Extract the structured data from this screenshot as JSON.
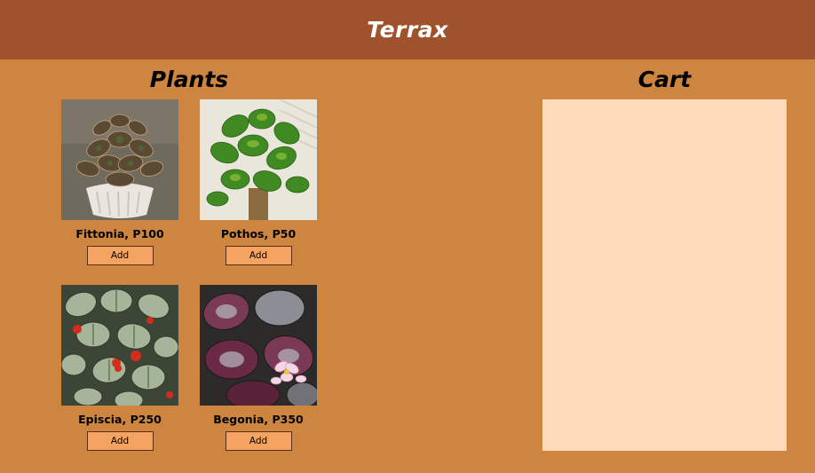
{
  "app": {
    "title": "Terrax"
  },
  "plants": {
    "title": "Plants",
    "items": [
      {
        "name": "Fittonia",
        "price": "P100",
        "label": "Fittonia, P100",
        "add_label": "Add"
      },
      {
        "name": "Pothos",
        "price": "P50",
        "label": "Pothos, P50",
        "add_label": "Add"
      },
      {
        "name": "Episcia",
        "price": "P250",
        "label": "Episcia, P250",
        "add_label": "Add"
      },
      {
        "name": "Begonia",
        "price": "P350",
        "label": "Begonia, P350",
        "add_label": "Add"
      }
    ]
  },
  "cart": {
    "title": "Cart",
    "items": []
  },
  "colors": {
    "header": "#a0522d",
    "background": "#cd853f",
    "cart_panel": "#ffdab9",
    "button": "#f4a460"
  }
}
